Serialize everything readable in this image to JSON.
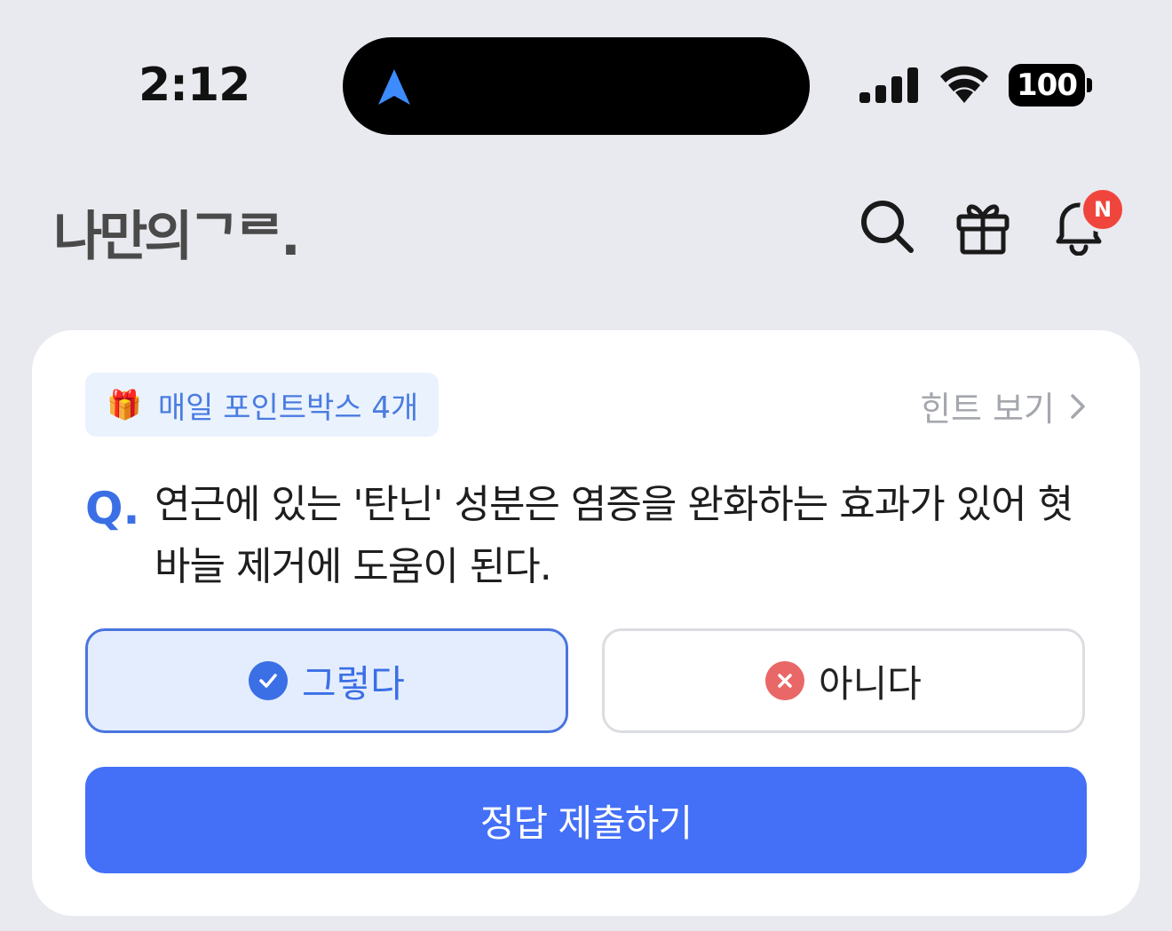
{
  "status_bar": {
    "time": "2:12",
    "battery": "100"
  },
  "header": {
    "logo": "나만의ᄀᄅ.",
    "notification_badge": "N"
  },
  "quiz": {
    "points_label": "매일 포인트박스 4개",
    "hint_label": "힌트 보기",
    "question_mark": "Q.",
    "question": "연근에 있는 '탄닌' 성분은 염증을 완화하는 효과가 있어 혓바늘 제거에 도움이 된다.",
    "option_yes": "그렇다",
    "option_no": "아니다",
    "selected": "option_yes",
    "submit_label": "정답 제출하기"
  },
  "colors": {
    "accent": "#4470f7",
    "selected_bg": "#e4edfd",
    "wrong_icon": "#ea6767",
    "badge": "#f0453c"
  },
  "icons": [
    "navigation-arrow-icon",
    "signal-icon",
    "wifi-icon",
    "battery-icon",
    "search-icon",
    "gift-icon",
    "bell-icon",
    "chevron-right-icon",
    "check-circle-icon",
    "x-circle-icon"
  ]
}
